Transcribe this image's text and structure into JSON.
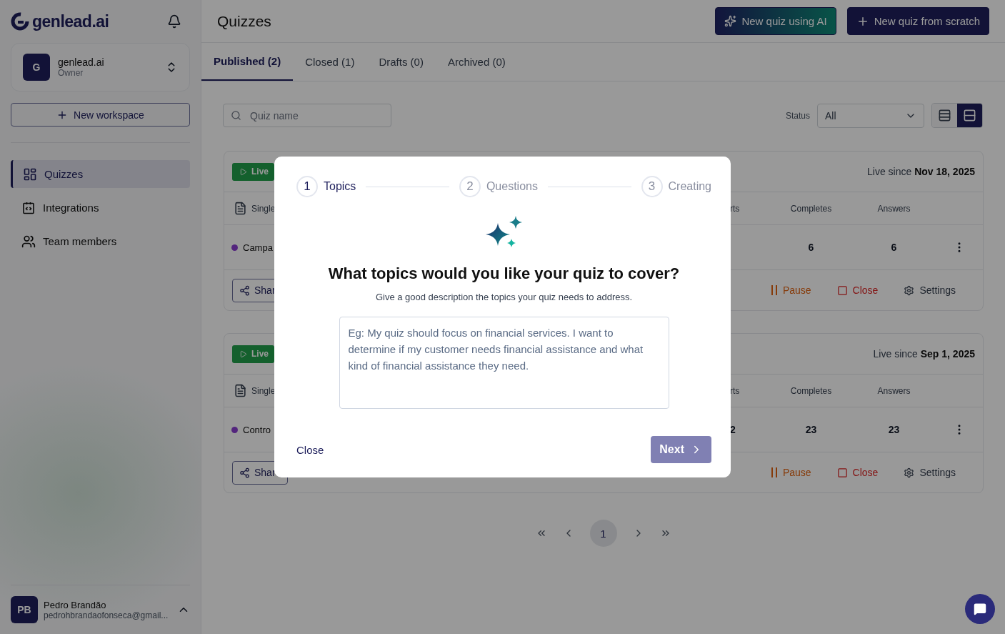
{
  "sidebar": {
    "logo": "genlead.ai",
    "workspace": {
      "avatar": "G",
      "name": "genlead.ai",
      "role": "Owner"
    },
    "new_workspace": "New workspace",
    "nav": [
      {
        "label": "Quizzes",
        "kind": "quizzes",
        "selected": true
      },
      {
        "label": "Integrations",
        "kind": "integrations",
        "selected": false
      },
      {
        "label": "Team members",
        "kind": "team",
        "selected": false
      }
    ],
    "user": {
      "initials": "PB",
      "name": "Pedro Brandão",
      "email": "pedrohbrandaofonseca@gmail..."
    }
  },
  "header": {
    "title": "Quizzes",
    "buttons": [
      {
        "label": "New quiz using AI",
        "kind": "ai"
      },
      {
        "label": "New quiz from scratch",
        "kind": "scratch"
      }
    ]
  },
  "tabs": [
    {
      "label": "Published (2)",
      "selected": true
    },
    {
      "label": "Closed (1)",
      "selected": false
    },
    {
      "label": "Drafts (0)",
      "selected": false
    },
    {
      "label": "Archived (0)",
      "selected": false
    }
  ],
  "filters": {
    "search_placeholder": "Quiz name",
    "status_label": "Status",
    "status_value": "All",
    "views": [
      {
        "kind": "list",
        "selected": false
      },
      {
        "kind": "cards",
        "selected": true
      }
    ]
  },
  "quizzes": [
    {
      "status": {
        "label": "Live",
        "kind": "live"
      },
      "live_since_label": "Live since",
      "live_since_date": "Nov 18, 2025",
      "type": "Single",
      "name": "Campa",
      "share": "Shar",
      "stats": [
        {
          "header": "rts"
        },
        {
          "header": "Completes",
          "value": "6"
        },
        {
          "header": "Answers",
          "value": "6"
        }
      ],
      "actions": [
        {
          "label": "Pause",
          "kind": "pause"
        },
        {
          "label": "Close",
          "kind": "close"
        },
        {
          "label": "Settings",
          "kind": "settings"
        }
      ]
    },
    {
      "status": {
        "label": "Live",
        "kind": "live"
      },
      "live_since_label": "Live since",
      "live_since_date": "Sep 1, 2025",
      "type": "Single",
      "name": "Contro",
      "share": "Shar",
      "stats": [
        {
          "header": "rts",
          "value": "2"
        },
        {
          "header": "Completes",
          "value": "23"
        },
        {
          "header": "Answers",
          "value": "23"
        }
      ],
      "actions": [
        {
          "label": "Pause",
          "kind": "pause"
        },
        {
          "label": "Close",
          "kind": "close"
        },
        {
          "label": "Settings",
          "kind": "settings"
        }
      ]
    }
  ],
  "pagination": {
    "pages": [
      {
        "label": "1",
        "selected": true
      }
    ]
  },
  "modal": {
    "steps": [
      {
        "number": "1",
        "label": "Topics",
        "selected": true
      },
      {
        "number": "2",
        "label": "Questions",
        "selected": false
      },
      {
        "number": "3",
        "label": "Creating",
        "selected": false
      }
    ],
    "heading": "What topics would you like your quiz to cover?",
    "subheading": "Give a good description the topics your quiz needs to address.",
    "placeholder": "Eg: My quiz should focus on financial services. I want to determine if my customer needs financial assistance and what kind of financial assistance they need.",
    "close": "Close",
    "next": {
      "label": "Next",
      "disabled": true
    }
  }
}
